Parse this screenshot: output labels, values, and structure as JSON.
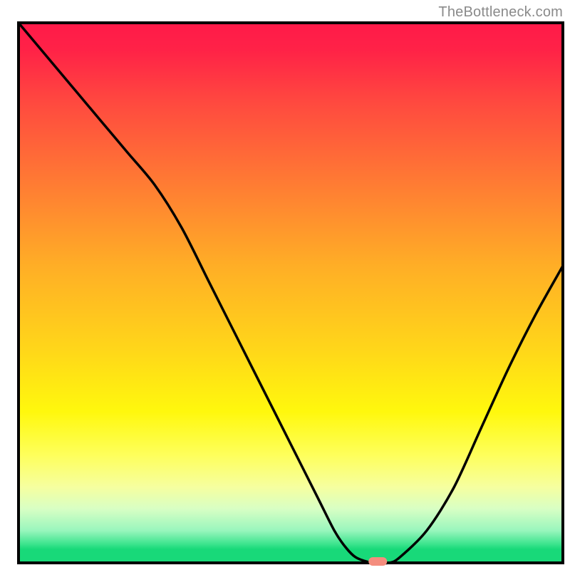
{
  "watermark": "TheBottleneck.com",
  "chart_data": {
    "type": "line",
    "title": "",
    "xlabel": "",
    "ylabel": "",
    "xlim": [
      0,
      100
    ],
    "ylim": [
      0,
      100
    ],
    "series": [
      {
        "name": "bottleneck-curve",
        "x": [
          0,
          5,
          10,
          15,
          20,
          25,
          30,
          35,
          40,
          45,
          50,
          55,
          58,
          60,
          62,
          65,
          68,
          70,
          75,
          80,
          85,
          90,
          95,
          100
        ],
        "values": [
          100,
          94,
          88,
          82,
          76,
          70,
          62,
          52,
          42,
          32,
          22,
          12,
          6,
          3,
          1,
          0,
          0,
          1,
          6,
          14,
          25,
          36,
          46,
          55
        ]
      }
    ],
    "optimum_marker": {
      "x": 66,
      "y": 0,
      "color": "#f48d7e"
    },
    "background_gradient": {
      "stops": [
        {
          "pos": 0.0,
          "color": "#ff1a49"
        },
        {
          "pos": 0.05,
          "color": "#ff2247"
        },
        {
          "pos": 0.15,
          "color": "#ff4a3f"
        },
        {
          "pos": 0.3,
          "color": "#ff7c33"
        },
        {
          "pos": 0.45,
          "color": "#ffae26"
        },
        {
          "pos": 0.6,
          "color": "#ffd51a"
        },
        {
          "pos": 0.72,
          "color": "#fff80d"
        },
        {
          "pos": 0.8,
          "color": "#feff5b"
        },
        {
          "pos": 0.86,
          "color": "#f6ffa0"
        },
        {
          "pos": 0.9,
          "color": "#d8ffc4"
        },
        {
          "pos": 0.94,
          "color": "#99f6bd"
        },
        {
          "pos": 0.965,
          "color": "#3de48e"
        },
        {
          "pos": 0.975,
          "color": "#18d979"
        },
        {
          "pos": 1.0,
          "color": "#18d979"
        }
      ]
    },
    "border_color": "#000000"
  }
}
